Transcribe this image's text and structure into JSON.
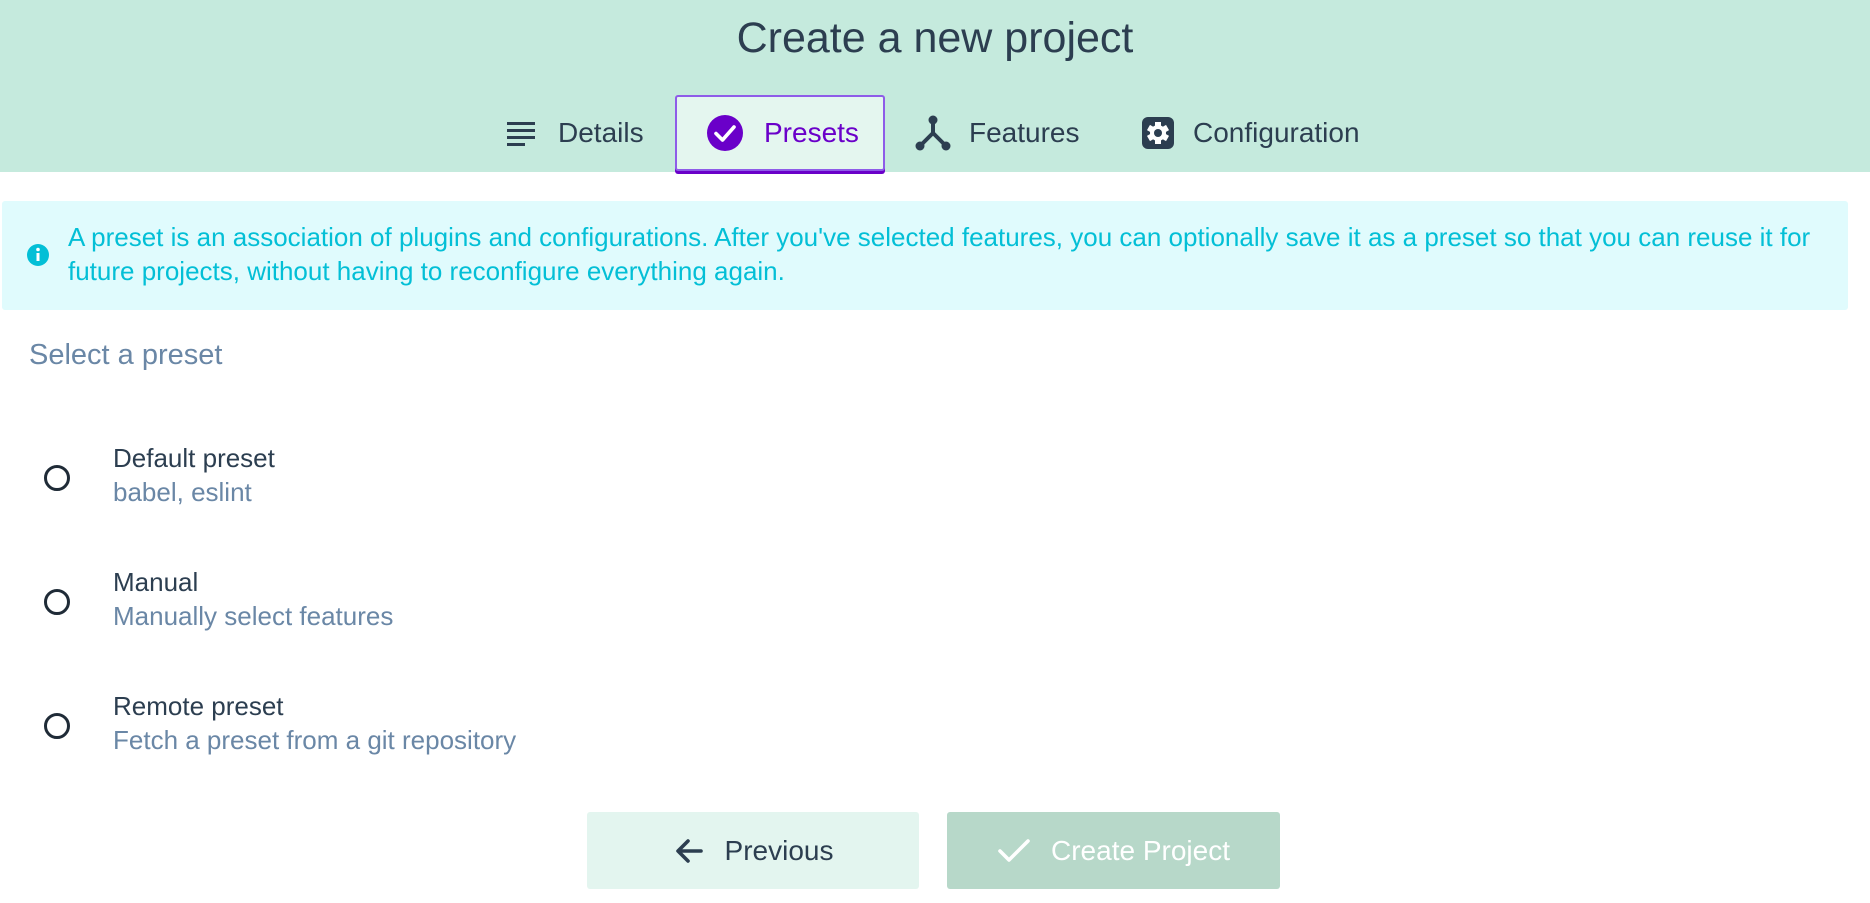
{
  "header": {
    "title": "Create a new project",
    "background_color": "#c5eadd"
  },
  "tabs": [
    {
      "label": "Details",
      "icon": "subject-icon",
      "active": false
    },
    {
      "label": "Presets",
      "icon": "check-circle-icon",
      "active": true
    },
    {
      "label": "Features",
      "icon": "call-split-icon",
      "active": false
    },
    {
      "label": "Configuration",
      "icon": "settings-gear-icon",
      "active": false
    }
  ],
  "info": {
    "icon": "info-icon",
    "text": "A preset is an association of plugins and configurations. After you've selected features, you can optionally save it as a preset so that you can reuse it for future projects, without having to reconfigure everything again."
  },
  "presets": {
    "title": "Select a preset",
    "options": [
      {
        "name": "Default preset",
        "description": "babel, eslint",
        "selected": false
      },
      {
        "name": "Manual",
        "description": "Manually select features",
        "selected": false
      },
      {
        "name": "Remote preset",
        "description": "Fetch a preset from a git repository",
        "selected": false
      }
    ]
  },
  "actions": {
    "previous_label": "Previous",
    "create_label": "Create Project",
    "create_disabled": true
  },
  "colors": {
    "accent": "#6a00c9",
    "info_text": "#03bfd6",
    "info_bg": "#e0fbfd",
    "text_dark": "#2c3e50",
    "text_muted": "#6a87a6"
  }
}
